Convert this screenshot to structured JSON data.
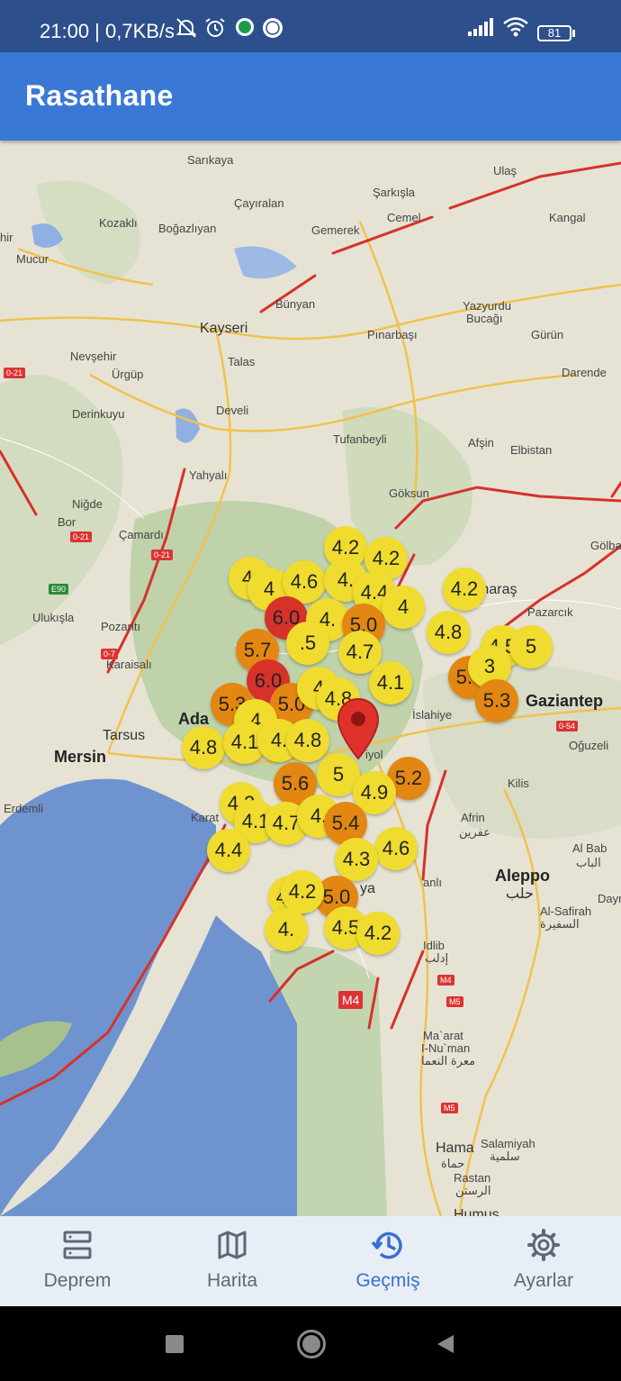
{
  "status_bar": {
    "time_and_speed": "21:00 | 0,7KB/s",
    "battery": "81"
  },
  "app_bar": {
    "title": "Rasathane"
  },
  "map": {
    "places": [
      {
        "id": "sarikaya",
        "text": "Sarıkaya"
      },
      {
        "id": "ulas",
        "text": "Ulaş"
      },
      {
        "id": "sarkisla",
        "text": "Şarkışla"
      },
      {
        "id": "cayiralan",
        "text": "Çayıralan"
      },
      {
        "id": "kozakli",
        "text": "Kozaklı"
      },
      {
        "id": "bogazliyan",
        "text": "Boğazlıyan"
      },
      {
        "id": "cemel",
        "text": "Cemel"
      },
      {
        "id": "kangal",
        "text": "Kangal"
      },
      {
        "id": "gemerek",
        "text": "Gemerek"
      },
      {
        "id": "mucur",
        "text": "Mucur"
      },
      {
        "id": "hir",
        "text": "hir"
      },
      {
        "id": "bunyan",
        "text": "Bünyan"
      },
      {
        "id": "yazyurdu",
        "text": "Yazyurdu"
      },
      {
        "id": "bucagi",
        "text": "Bucağı"
      },
      {
        "id": "kayseri",
        "text": "Kayseri"
      },
      {
        "id": "pinarbasi",
        "text": "Pınarbaşı"
      },
      {
        "id": "gurun",
        "text": "Gürün"
      },
      {
        "id": "nevsehir",
        "text": "Nevşehir"
      },
      {
        "id": "talas",
        "text": "Talas"
      },
      {
        "id": "urgup",
        "text": "Ürgüp"
      },
      {
        "id": "darende",
        "text": "Darende"
      },
      {
        "id": "derinkuyu",
        "text": "Derinkuyu"
      },
      {
        "id": "develi",
        "text": "Develi"
      },
      {
        "id": "tufanbeyli",
        "text": "Tufanbeyli"
      },
      {
        "id": "afsin",
        "text": "Afşin"
      },
      {
        "id": "elbistan",
        "text": "Elbistan"
      },
      {
        "id": "yahyali",
        "text": "Yahyalı"
      },
      {
        "id": "goksun",
        "text": "Göksun"
      },
      {
        "id": "nigde",
        "text": "Niğde"
      },
      {
        "id": "bor",
        "text": "Bor"
      },
      {
        "id": "camardi",
        "text": "Çamardı"
      },
      {
        "id": "golba",
        "text": "Gölba"
      },
      {
        "id": "kahramanmaras",
        "text": "K     nmaraş"
      },
      {
        "id": "pazarcik",
        "text": "Pazarcık"
      },
      {
        "id": "ulukisla",
        "text": "Ulukışla"
      },
      {
        "id": "pozanti",
        "text": "Pozantı"
      },
      {
        "id": "karaisali",
        "text": "Karaisalı"
      },
      {
        "id": "gaziantep",
        "text": "Gaziantep"
      },
      {
        "id": "adana",
        "text": "Ada"
      },
      {
        "id": "islahiye",
        "text": "İslahiye"
      },
      {
        "id": "tarsus",
        "text": "Tarsus"
      },
      {
        "id": "oguzeli",
        "text": "Oğuzeli"
      },
      {
        "id": "mersin",
        "text": "Mersin"
      },
      {
        "id": "osmaniye",
        "text": "iyol"
      },
      {
        "id": "kilis",
        "text": "Kilis"
      },
      {
        "id": "erdemli",
        "text": "Erdemli"
      },
      {
        "id": "karatas",
        "text": "Karat"
      },
      {
        "id": "afrin",
        "text": "Afrin"
      },
      {
        "id": "afrin_ar",
        "text": "عفرين"
      },
      {
        "id": "albab",
        "text": "Al Bab"
      },
      {
        "id": "albab_ar",
        "text": "الباب"
      },
      {
        "id": "aleppo",
        "text": "Aleppo"
      },
      {
        "id": "aleppo_ar",
        "text": "حلب"
      },
      {
        "id": "alsafirah",
        "text": "Al-Safirah"
      },
      {
        "id": "alsafirah_ar",
        "text": "السفيرة"
      },
      {
        "id": "dayr",
        "text": "Dayr"
      },
      {
        "id": "antakya",
        "text": "ya"
      },
      {
        "id": "idlib",
        "text": "Idlib"
      },
      {
        "id": "idlib_ar",
        "text": "إدلب"
      },
      {
        "id": "maarat",
        "text": "Ma`arat"
      },
      {
        "id": "numan",
        "text": "I-Nu`man"
      },
      {
        "id": "maarat_ar",
        "text": "معرة النعما"
      },
      {
        "id": "hama",
        "text": "Hama"
      },
      {
        "id": "hama_ar",
        "text": "حماة"
      },
      {
        "id": "salamiyah",
        "text": "Salamiyah"
      },
      {
        "id": "salamiyah_ar",
        "text": "سلمية"
      },
      {
        "id": "rastan",
        "text": "Rastan"
      },
      {
        "id": "rastan_ar",
        "text": "الرستن"
      },
      {
        "id": "humus",
        "text": "Humus"
      },
      {
        "id": "anli",
        "text": "anlı"
      }
    ],
    "road_signs": [
      "0-21",
      "0-21",
      "0-21",
      "0-7",
      "E90",
      "0-54",
      "M4",
      "M5",
      "M5",
      "M4"
    ],
    "earthquakes": [
      {
        "mag": "4.",
        "level": "yellow"
      },
      {
        "mag": "4.2",
        "level": "yellow"
      },
      {
        "mag": "4.2",
        "level": "yellow"
      },
      {
        "mag": "4",
        "level": "yellow"
      },
      {
        "mag": "4.6",
        "level": "yellow"
      },
      {
        "mag": "4.",
        "level": "yellow"
      },
      {
        "mag": "4.4",
        "level": "yellow"
      },
      {
        "mag": "4.2",
        "level": "yellow"
      },
      {
        "mag": "4",
        "level": "yellow"
      },
      {
        "mag": "6.0",
        "level": "red"
      },
      {
        "mag": "4.",
        "level": "yellow"
      },
      {
        "mag": "5.0",
        "level": "orange"
      },
      {
        "mag": "4.8",
        "level": "yellow"
      },
      {
        "mag": "4.5",
        "level": "yellow"
      },
      {
        "mag": "5.7",
        "level": "orange"
      },
      {
        "mag": ".5",
        "level": "yellow"
      },
      {
        "mag": "4.7",
        "level": "yellow"
      },
      {
        "mag": "5",
        "level": "yellow"
      },
      {
        "mag": "6.0",
        "level": "red"
      },
      {
        "mag": "5.3",
        "level": "orange"
      },
      {
        "mag": "3",
        "level": "yellow"
      },
      {
        "mag": "4.1",
        "level": "yellow"
      },
      {
        "mag": "5.3",
        "level": "orange"
      },
      {
        "mag": "5.0",
        "level": "orange"
      },
      {
        "mag": "4",
        "level": "yellow"
      },
      {
        "mag": "4.8",
        "level": "yellow"
      },
      {
        "mag": "5.3",
        "level": "orange"
      },
      {
        "mag": "4",
        "level": "yellow"
      },
      {
        "mag": "4.8",
        "level": "yellow"
      },
      {
        "mag": "4.1",
        "level": "yellow"
      },
      {
        "mag": "4.",
        "level": "yellow"
      },
      {
        "mag": "4.8",
        "level": "yellow"
      },
      {
        "mag": "5",
        "level": "yellow"
      },
      {
        "mag": "5.2",
        "level": "orange"
      },
      {
        "mag": "5.6",
        "level": "orange"
      },
      {
        "mag": "4.9",
        "level": "yellow"
      },
      {
        "mag": "4.2",
        "level": "yellow"
      },
      {
        "mag": "4.1",
        "level": "yellow"
      },
      {
        "mag": "4.7",
        "level": "yellow"
      },
      {
        "mag": "4.",
        "level": "yellow"
      },
      {
        "mag": "5.4",
        "level": "orange"
      },
      {
        "mag": "4.4",
        "level": "yellow"
      },
      {
        "mag": "4.6",
        "level": "yellow"
      },
      {
        "mag": "4.3",
        "level": "yellow"
      },
      {
        "mag": "4.7",
        "level": "yellow"
      },
      {
        "mag": "5.0",
        "level": "orange"
      },
      {
        "mag": "4.2",
        "level": "yellow"
      },
      {
        "mag": "4.",
        "level": "yellow"
      },
      {
        "mag": "4.5",
        "level": "yellow"
      },
      {
        "mag": "4.2",
        "level": "yellow"
      },
      {
        "mag": "4.",
        "level": "yellow"
      }
    ]
  },
  "bottom_nav": {
    "items": [
      {
        "label": "Deprem",
        "icon": "list-icon",
        "active": false
      },
      {
        "label": "Harita",
        "icon": "map-icon",
        "active": false
      },
      {
        "label": "Geçmiş",
        "icon": "history-icon",
        "active": true
      },
      {
        "label": "Ayarlar",
        "icon": "gear-icon",
        "active": false
      }
    ]
  },
  "colors": {
    "app_bar": "#3a78d6",
    "status_bar": "#2d4f8c",
    "active_nav": "#3a6fd0",
    "marker_yellow": "#f0dc2e",
    "marker_orange": "#e38712",
    "marker_red": "#d6322a",
    "fault_line": "#d6322a"
  }
}
